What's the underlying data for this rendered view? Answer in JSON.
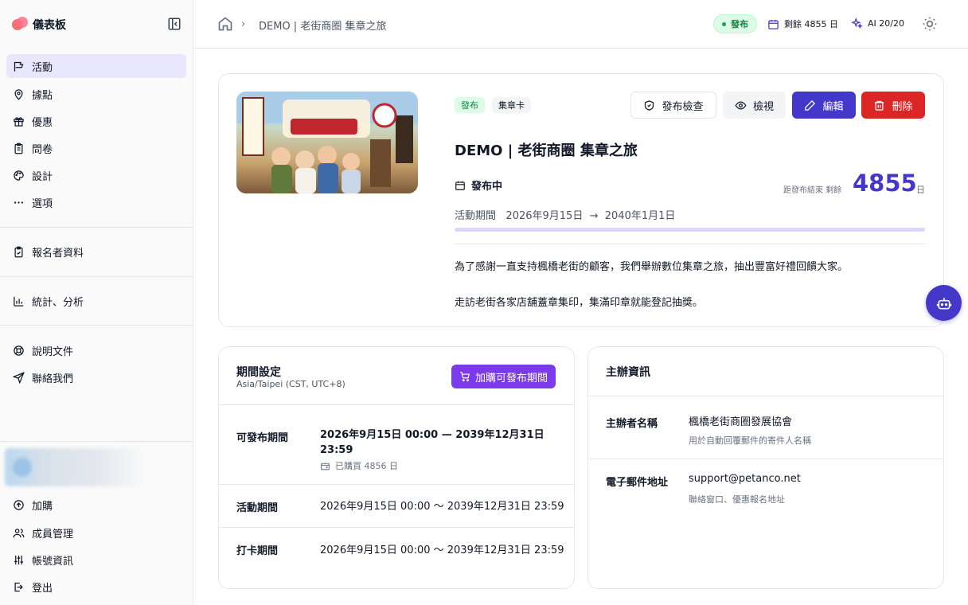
{
  "sidebar": {
    "title": "儀表板",
    "nav_main": [
      {
        "label": "活動",
        "icon": "flag-icon",
        "active": true
      },
      {
        "label": "據點",
        "icon": "map-pin-icon"
      },
      {
        "label": "優惠",
        "icon": "gift-icon"
      },
      {
        "label": "問卷",
        "icon": "clipboard-list-icon"
      },
      {
        "label": "設計",
        "icon": "palette-icon"
      },
      {
        "label": "選項",
        "icon": "more-horizontal-icon"
      }
    ],
    "nav_registrants": {
      "label": "報名者資料",
      "icon": "clipboard-check-icon"
    },
    "nav_stats": {
      "label": "統計、分析",
      "icon": "bar-chart-icon"
    },
    "nav_help": [
      {
        "label": "說明文件",
        "icon": "lifebuoy-icon"
      },
      {
        "label": "聯絡我們",
        "icon": "send-icon"
      }
    ],
    "nav_bottom": [
      {
        "label": "加購",
        "icon": "arrow-up-circle-icon"
      },
      {
        "label": "成員管理",
        "icon": "users-icon"
      },
      {
        "label": "帳號資訊",
        "icon": "sliders-icon"
      },
      {
        "label": "登出",
        "icon": "logout-icon"
      }
    ]
  },
  "topbar": {
    "breadcrumb": "DEMO | 老街商圈 集章之旅",
    "status": "發布",
    "remaining": "剩餘 4855 日",
    "ai_quota": "AI 20/20"
  },
  "event": {
    "badges": [
      "發布",
      "集章卡"
    ],
    "buttons": {
      "check": "發布檢查",
      "view": "檢視",
      "edit": "編輯",
      "delete": "刪除"
    },
    "title": "DEMO | 老街商圈 集章之旅",
    "state": "發布中",
    "remaining_label": "距發布結束 剩餘",
    "remaining_days": "4855",
    "remaining_unit": "日",
    "period_label": "活動期間",
    "period_start": "2026年9月15日",
    "period_arrow": "→",
    "period_end": "2040年1月1日",
    "progress_fraction": 0.0,
    "description": [
      "為了感謝一直支持楓橋老街的顧客，我們舉辦數位集章之旅，抽出豐富好禮回饋大家。",
      "走訪老街各家店舖蓋章集印，集滿印章就能登記抽獎。"
    ]
  },
  "period_settings": {
    "title": "期間設定",
    "timezone": "Asia/Taipei (CST, UTC+8)",
    "buy_button": "加購可發布期間",
    "rows": [
      {
        "label": "可發布期間",
        "value_line1": "2026年9月15日 00:00 — 2039年12月31日",
        "value_line2": "23:59",
        "note": "已購買 4856 日"
      },
      {
        "label": "活動期間",
        "value": "2026年9月15日 00:00 〜 2039年12月31日 23:59"
      },
      {
        "label": "打卡期間",
        "value": "2026年9月15日 00:00 〜 2039年12月31日 23:59"
      }
    ]
  },
  "organizer": {
    "title": "主辦資訊",
    "rows": [
      {
        "label": "主辦者名稱",
        "value": "楓橋老街商圈發展協會",
        "note": "用於自動回覆郵件的寄件人名稱"
      },
      {
        "label": "電子郵件地址",
        "value": "support@petanco.net",
        "note": "聯絡窗口、優惠報名地址"
      }
    ]
  },
  "colors": {
    "accent": "#4338ca",
    "purple": "#7c3aed",
    "danger": "#dc2626",
    "success_bg": "#dcfce7",
    "success_text": "#15803d"
  }
}
